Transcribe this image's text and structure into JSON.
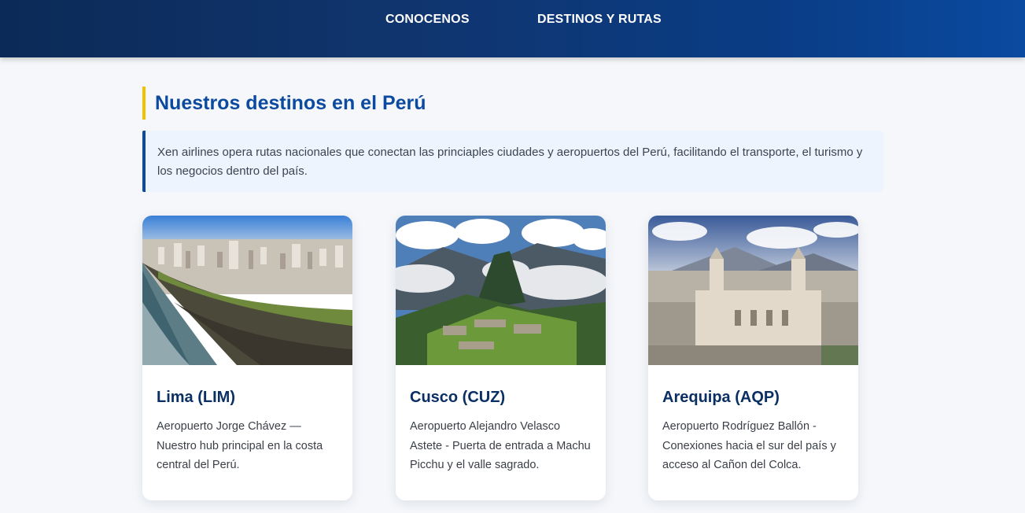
{
  "nav": {
    "items": [
      "CONOCENOS",
      "DESTINOS Y RUTAS"
    ]
  },
  "section": {
    "title": "Nuestros destinos en el Perú",
    "intro": "Xen airlines opera rutas nacionales que conectan las princiaples ciudades y aeropuertos del Perú, facilitando el transporte, el turismo y los negocios dentro del país."
  },
  "destinations": [
    {
      "title": "Lima (LIM)",
      "description": "Aeropuerto Jorge Chávez — Nuestro hub principal en la costa central del Perú.",
      "image": "lima-coastline-photo"
    },
    {
      "title": "Cusco (CUZ)",
      "description": "Aeropuerto Alejandro Velasco Astete - Puerta de entrada a Machu Picchu y el valle sagrado.",
      "image": "machu-picchu-photo"
    },
    {
      "title": "Arequipa (AQP)",
      "description": "Aeropuerto Rodríguez Ballón - Conexiones hacia el sur del país y acceso al Cañon del Colca.",
      "image": "arequipa-cathedral-photo"
    }
  ],
  "colors": {
    "nav_bg": "#0b2a57",
    "title_blue": "#0b4a9e",
    "accent_yellow": "#f2c200",
    "card_title": "#0a2f63"
  }
}
